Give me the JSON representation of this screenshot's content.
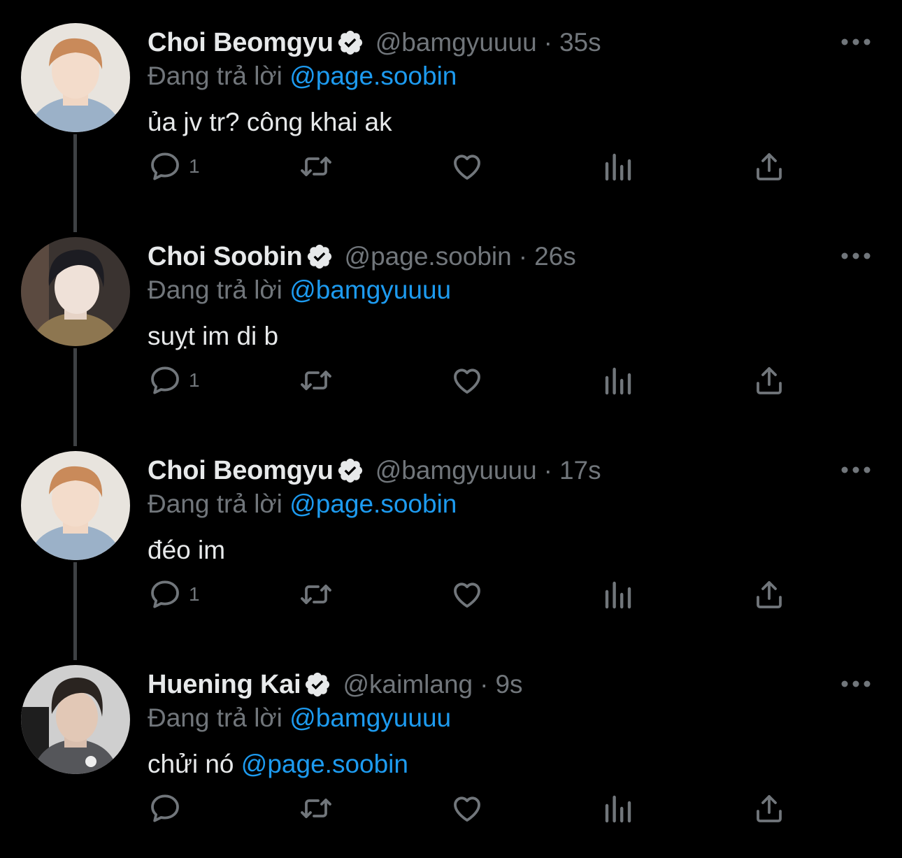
{
  "tweets": [
    {
      "name": "Choi Beomgyu",
      "handle": "@bamgyuuuu",
      "separator": "·",
      "time": "35s",
      "reply_prefix": "Đang trả lời",
      "reply_to": "@page.soobin",
      "text": "ủa jv tr? công khai ak",
      "text_mention": "",
      "reply_count": "1",
      "avatar": "avatar-beomgyu"
    },
    {
      "name": "Choi Soobin",
      "handle": "@page.soobin",
      "separator": "·",
      "time": "26s",
      "reply_prefix": "Đang trả lời",
      "reply_to": "@bamgyuuuu",
      "text": "suỵt im di b",
      "text_mention": "",
      "reply_count": "1",
      "avatar": "avatar-soobin"
    },
    {
      "name": "Choi Beomgyu",
      "handle": "@bamgyuuuu",
      "separator": "·",
      "time": "17s",
      "reply_prefix": "Đang trả lời",
      "reply_to": "@page.soobin",
      "text": "đéo im",
      "text_mention": "",
      "reply_count": "1",
      "avatar": "avatar-beomgyu"
    },
    {
      "name": "Huening Kai",
      "handle": "@kaimlang",
      "separator": "·",
      "time": "9s",
      "reply_prefix": "Đang trả lời",
      "reply_to": "@bamgyuuuu",
      "text": "chửi nó ",
      "text_mention": "@page.soobin",
      "reply_count": "",
      "avatar": "avatar-kai"
    }
  ],
  "colors": {
    "background": "#000000",
    "text": "#e7e9ea",
    "secondary": "#71767b",
    "link": "#1d9bf0",
    "thread_line": "#3e4144"
  },
  "icons": [
    "reply-icon",
    "retweet-icon",
    "like-icon",
    "views-icon",
    "share-icon",
    "more-icon",
    "verified-badge-icon"
  ]
}
